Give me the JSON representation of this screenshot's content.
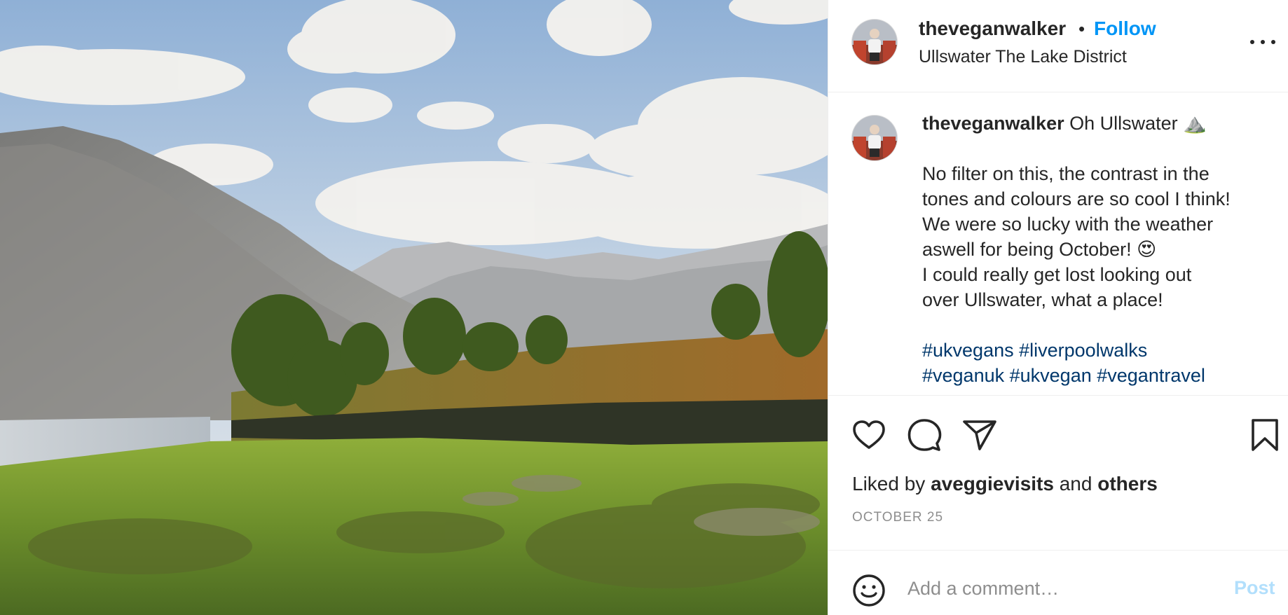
{
  "post": {
    "photo_alt": "Ullswater landscape photo",
    "author": {
      "username": "theveganwalker",
      "avatar_icon": "profile-avatar"
    },
    "header": {
      "separator": "•",
      "follow_label": "Follow",
      "location": "Ullswater The Lake District",
      "more_icon": "more-horizontal-icon"
    },
    "caption": {
      "username": "theveganwalker",
      "first_line": "Oh Ullswater ⛰️",
      "paragraph_lines": [
        "No filter on this, the contrast in the",
        "tones and colours are so cool I think!",
        "We were so lucky with the weather",
        "aswell for being October! 😍",
        "I could really get lost looking out",
        "over Ullswater, what a place!"
      ],
      "hashtags": [
        "#ukvegans",
        "#liverpoolwalks",
        "#veganuk",
        "#ukvegan",
        "#vegantravel"
      ]
    },
    "actions": {
      "like_icon": "heart-icon",
      "comment_icon": "comment-icon",
      "share_icon": "share-icon",
      "save_icon": "bookmark-icon"
    },
    "likes": {
      "prefix": "Liked by",
      "user": "aveggievisits",
      "conjunction": "and",
      "others": "others"
    },
    "date": "OCTOBER 25",
    "comment": {
      "placeholder": "Add a comment…",
      "post_label": "Post",
      "emoji_icon": "emoji-icon"
    },
    "colors": {
      "accent": "#0095f6",
      "hashtag": "#00376b",
      "post_disabled": "#b2dffc",
      "muted": "#8e8e8e"
    }
  }
}
